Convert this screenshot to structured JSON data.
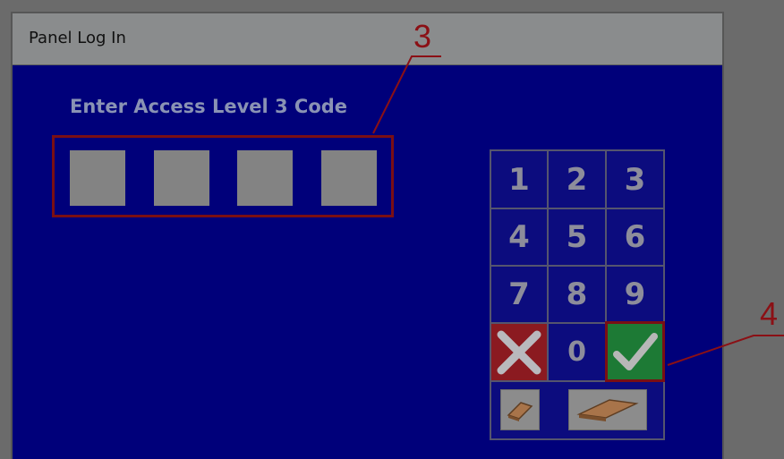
{
  "window": {
    "title": "Panel Log In"
  },
  "prompt": "Enter Access Level 3 Code",
  "code_boxes": [
    "",
    "",
    "",
    ""
  ],
  "keypad": {
    "digits": [
      "1",
      "2",
      "3",
      "4",
      "5",
      "6",
      "7",
      "8",
      "9",
      "0"
    ],
    "cancel_icon": "x-icon",
    "ok_icon": "checkmark-icon",
    "backspace_icon": "eraser-small-icon",
    "clear_icon": "eraser-large-icon"
  },
  "callouts": {
    "code_entry": "3",
    "ok_button": "4"
  },
  "colors": {
    "panel_bg": "#00007a",
    "cancel": "#8b1a20",
    "ok": "#1d7a35",
    "callout": "#8b1015"
  }
}
